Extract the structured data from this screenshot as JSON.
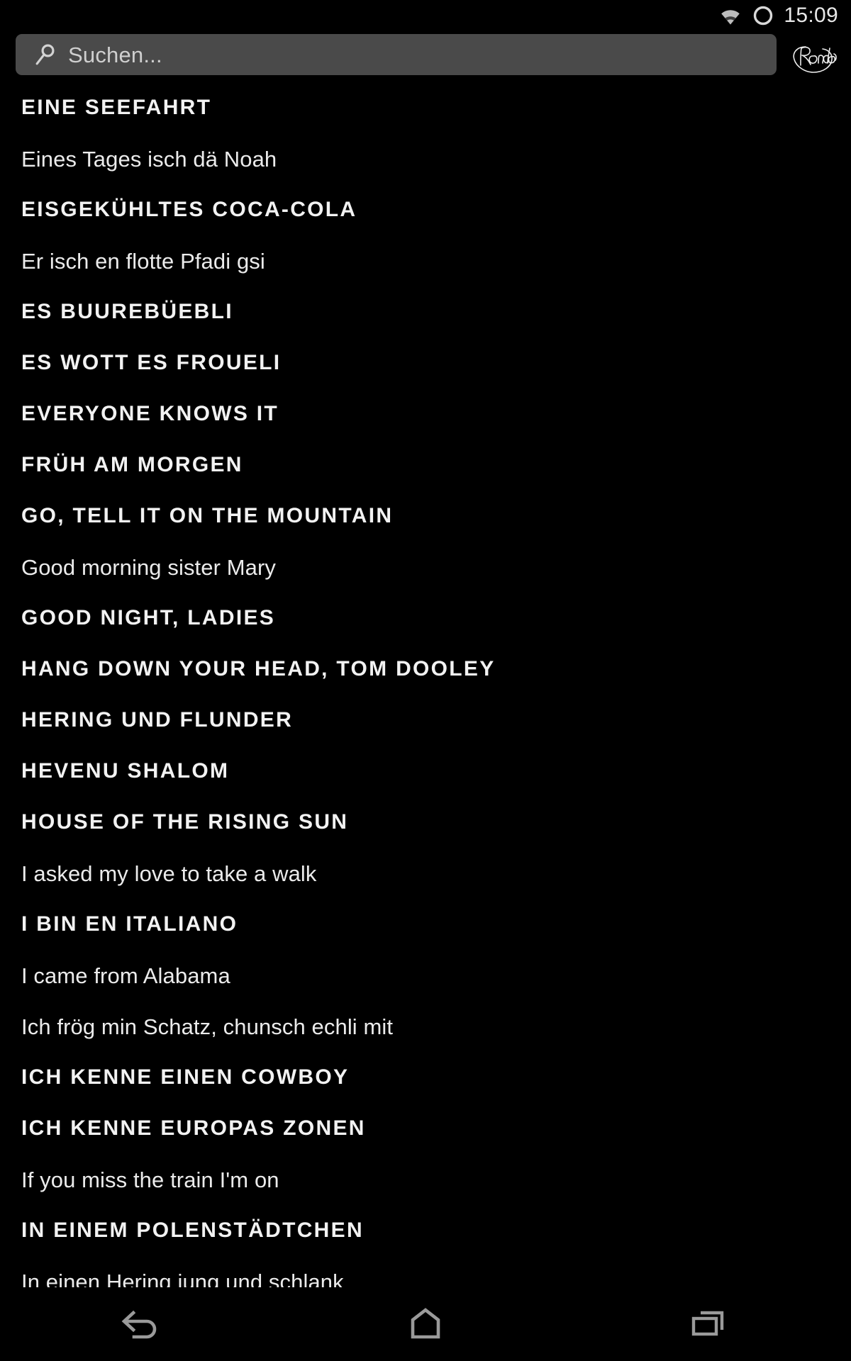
{
  "statusbar": {
    "time": "15:09",
    "icons": [
      "wifi-icon",
      "ring-icon"
    ]
  },
  "search": {
    "placeholder": "Suchen...",
    "value": "",
    "icon": "search-icon"
  },
  "logo": {
    "name": "rondo-logo",
    "text": "Rondo"
  },
  "songlist": [
    {
      "text": "EINE SEEFAHRT",
      "type": "title"
    },
    {
      "text": "Eines Tages isch dä Noah",
      "type": "firstline"
    },
    {
      "text": "EISGEKÜHLTES COCA-COLA",
      "type": "title"
    },
    {
      "text": "Er isch en flotte Pfadi gsi",
      "type": "firstline"
    },
    {
      "text": "ES BUUREBÜEBLI",
      "type": "title"
    },
    {
      "text": "ES WOTT ES FROUELI",
      "type": "title"
    },
    {
      "text": "EVERYONE KNOWS IT",
      "type": "title"
    },
    {
      "text": "FRÜH AM MORGEN",
      "type": "title"
    },
    {
      "text": "GO, TELL IT ON THE MOUNTAIN",
      "type": "title"
    },
    {
      "text": "Good morning sister Mary",
      "type": "firstline"
    },
    {
      "text": "GOOD NIGHT, LADIES",
      "type": "title"
    },
    {
      "text": "HANG DOWN YOUR HEAD, TOM DOOLEY",
      "type": "title"
    },
    {
      "text": "HERING UND FLUNDER",
      "type": "title"
    },
    {
      "text": "HEVENU SHALOM",
      "type": "title"
    },
    {
      "text": "HOUSE OF THE RISING SUN",
      "type": "title"
    },
    {
      "text": "I asked my love to take a walk",
      "type": "firstline"
    },
    {
      "text": "I BIN EN ITALIANO",
      "type": "title"
    },
    {
      "text": "I came from Alabama",
      "type": "firstline"
    },
    {
      "text": "Ich frög min Schatz, chunsch echli mit",
      "type": "firstline"
    },
    {
      "text": "ICH KENNE EINEN COWBOY",
      "type": "title"
    },
    {
      "text": "ICH KENNE EUROPAS ZONEN",
      "type": "title"
    },
    {
      "text": "If you miss the train I'm on",
      "type": "firstline"
    },
    {
      "text": "IN EINEM POLENSTÄDTCHEN",
      "type": "title"
    },
    {
      "text": "In einen Hering jung und schlank",
      "type": "firstline"
    }
  ],
  "navbar": [
    {
      "name": "back-button",
      "icon": "back-icon"
    },
    {
      "name": "home-button",
      "icon": "home-icon"
    },
    {
      "name": "recents-button",
      "icon": "recents-icon"
    }
  ],
  "colors": {
    "background": "#000000",
    "search_field": "#4a4a4a",
    "title_text": "#f2f2f2",
    "placeholder_text": "#cfcfcf",
    "nav_icon": "#9a9a9a"
  }
}
